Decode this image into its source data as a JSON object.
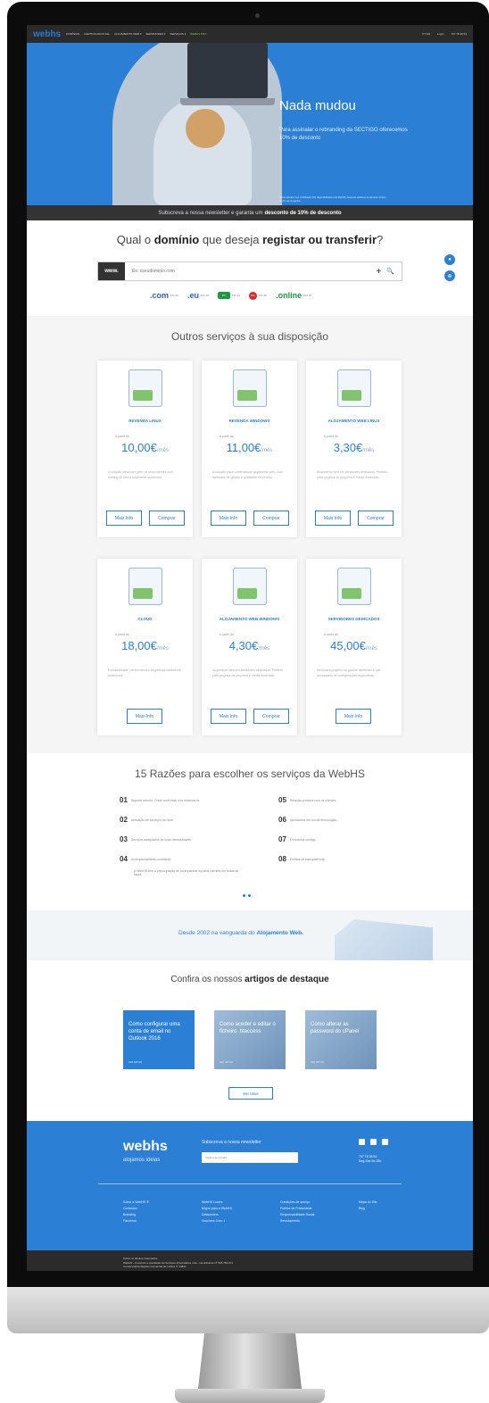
{
  "nav": {
    "logo_main": "web",
    "logo_accent": "hs",
    "items": [
      "DOMÍNIOS",
      "CERTIFICADOS SSL",
      "ALOJAMENTO WEB ▾",
      "SERVIDORES ▾",
      "SERVIÇOS ▾",
      "WEBHS PRO"
    ],
    "lang": "PT  EN",
    "login": "Login",
    "phone": "707 78 28 54"
  },
  "hero": {
    "title": "Nada mudou",
    "subtitle": "Para assinalar o rebranding da SECTIGO oferecemos 10% de desconto",
    "note": "Oferta aplicável nos Certificados SSL disponibilizados pela WebHS. Desconto aplicável na primeira compra, até fim da campanha."
  },
  "newsletter_bar": {
    "text": "Subscreva a nossa newsletter e garanta um",
    "highlight": "desconto de 10% de desconto"
  },
  "domain": {
    "q1": "Qual o",
    "q2": "domínio",
    "q3": "que deseja",
    "q4": "registar ou transferir",
    "q5": "?",
    "prefix": "www.",
    "placeholder": "Ex: oseudominio.com",
    "plus": "+",
    "search": "🔍",
    "tlds": [
      {
        "name": ".com",
        "price": "€11,00"
      },
      {
        "name": ".eu",
        "price": "€11,00"
      },
      {
        "name": "PT",
        "price": "€11,00"
      },
      {
        "name": "RS",
        "price": "€15,50"
      },
      {
        "name": ".online",
        "price": "€44,50"
      }
    ]
  },
  "services": {
    "title": "Outros serviços à sua disposição",
    "from": "A partir de",
    "per": "/mês",
    "more": "Mais Info",
    "buy": "Comprar",
    "cards": [
      {
        "title": "REVENDA LINUX",
        "price": "10,00€",
        "desc": "A solução ideal para gerir os seus clientes com hosting de forma totalmente autónoma."
      },
      {
        "title": "REVENDA WINDOWS",
        "price": "11,00€",
        "desc": "A solução para comercializar alojamento web, com facilidade de gestão e qualidade de serviço."
      },
      {
        "title": "ALOJAMENTO WEB LINUX",
        "price": "3,30€",
        "desc": "Alojamento web em servidores dedicados. Perfeito para projetos de pequena e média dimensão."
      },
      {
        "title": "CLOUD",
        "price": "18,00€",
        "desc": "Escalabilidade, performance e segurança totalmente acessíveis."
      },
      {
        "title": "ALOJAMENTO WEB WINDOWS",
        "price": "4,30€",
        "desc": "Alojamento web em servidores dedicados. Perfeito para projetos de pequena e média dimensão."
      },
      {
        "title": "SERVIDORES DEDICADOS",
        "price": "45,00€",
        "desc": "Ideal para projetos de grande dimensão e que necessitem de configurações específicas."
      }
    ]
  },
  "reasons": {
    "title": "15 Razões para escolher os serviços da WebHS",
    "items": [
      {
        "n": "01",
        "t": "Suporte remoto. Onde você está, nós estamos lá."
      },
      {
        "n": "02",
        "t": "Activação de serviços na hora."
      },
      {
        "n": "03",
        "t": "Serviços adequados às suas necessidades."
      },
      {
        "n": "04",
        "t": "Acompanhamento constante."
      },
      {
        "n": "05",
        "t": "Relação próxima com os clientes."
      },
      {
        "n": "06",
        "t": "Apostamos em novas tecnologias."
      },
      {
        "n": "07",
        "t": "Evoluímos contigo."
      },
      {
        "n": "08",
        "t": "Política de transparência."
      }
    ],
    "tooltip": "A WebHS tem a preocupação de acompanhar os seus clientes em todas as fases."
  },
  "since": {
    "text": "Desde 2002 na vanguarda do",
    "highlight": "Alojamento Web."
  },
  "articles": {
    "t1": "Confira os nossos",
    "t2": "artigos de destaque",
    "items": [
      {
        "title": "Como configurar uma conta de email no Outlook 2016",
        "more": "VER ARTIGO"
      },
      {
        "title": "Como aceder e editar o ficheiro .htaccess",
        "more": "VER ARTIGO"
      },
      {
        "title": "Como alterar as password do cPanel",
        "more": "VER ARTIGO"
      }
    ],
    "more": "Ver Mais"
  },
  "footer": {
    "logo": "webhs",
    "tagline": "alojamos ideias",
    "newsletter": "Subscreva a nossa newsletter",
    "email_placeholder": "Insira o seu email",
    "phone": "707 78 28 54",
    "hours": "Seg-Sex 9h-18h",
    "cols": [
      [
        "Sobre a WebHS ®",
        "Contactos",
        "Branding",
        "Parceiros"
      ],
      [
        "WebHS Lovers",
        "Migrar para a WebHS",
        "Datacenters",
        "Vouchers 3 em 1"
      ],
      [
        "Condições de serviço",
        "Política de Privacidade",
        "Responsabilidade Social",
        "Recrutamento"
      ],
      [
        "Mapa do Site",
        "Blog"
      ]
    ],
    "copy1": "Todos os direitos reservados.",
    "copy2": "WebHS - Comércio e prestação de Serviços Informáticos, Lda - Contribuinte Nº 506 756 971",
    "copy3": "Conservatória Registo Comercial de Lisboa nº 14831"
  }
}
